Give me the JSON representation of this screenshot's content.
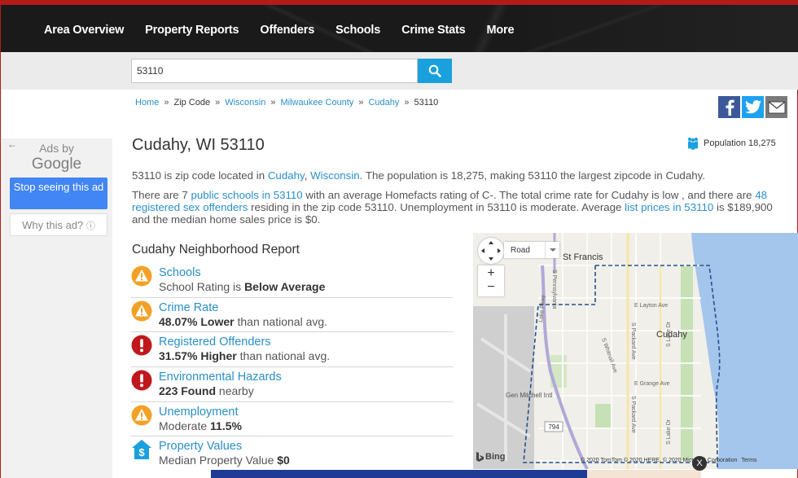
{
  "nav": {
    "items": [
      "Area Overview",
      "Property Reports",
      "Offenders",
      "Schools",
      "Crime Stats",
      "More"
    ]
  },
  "search": {
    "value": "53110"
  },
  "breadcrumb": {
    "home": "Home",
    "zip": "Zip Code",
    "state": "Wisconsin",
    "county": "Milwaukee County",
    "city": "Cudahy",
    "current": "53110",
    "sep": "»"
  },
  "ad": {
    "ads_by": "Ads by",
    "google": "Google",
    "stop": "Stop seeing this ad",
    "why": "Why this ad?",
    "back": "←",
    "info": "ⓘ"
  },
  "main": {
    "title": "Cudahy, WI 53110",
    "population": "Population 18,275",
    "p1_a": "53110 is zip code located in ",
    "p1_city": "Cudahy",
    "p1_comma": ", ",
    "p1_state": "Wisconsin",
    "p1_b": ". The population is 18,275, making 53110 the largest zipcode in Cudahy.",
    "p2_a": "There are 7 ",
    "p2_schools": "public schools in 53110",
    "p2_b": " with an average Homefacts rating of C-. The total crime rate for Cudahy is low , and there are ",
    "p2_offenders": "48 registered sex offenders",
    "p2_c": " residing in the zip code 53110. Unemployment in 53110 is moderate. Average ",
    "p2_prices": "list prices in 53110",
    "p2_d": " is $189,900 and the median home sales price is $0."
  },
  "report": {
    "title": "Cudahy Neighborhood Report",
    "items": [
      {
        "name": "Schools",
        "pre": "School Rating is ",
        "bold": "Below Average",
        "post": "",
        "kind": "warn"
      },
      {
        "name": "Crime Rate",
        "pre": "",
        "bold": "48.07% Lower",
        "post": " than national avg.",
        "kind": "warn"
      },
      {
        "name": "Registered Offenders",
        "pre": "",
        "bold": "31.57% Higher",
        "post": " than national avg.",
        "kind": "alert"
      },
      {
        "name": "Environmental Hazards",
        "pre": "",
        "bold": "223 Found",
        "post": " nearby",
        "kind": "alert"
      },
      {
        "name": "Unemployment",
        "pre": "Moderate ",
        "bold": "11.5%",
        "post": "",
        "kind": "warn"
      },
      {
        "name": "Property Values",
        "pre": "Median Property Value ",
        "bold": "$0",
        "post": "",
        "kind": "money"
      }
    ]
  },
  "map": {
    "mode": "Road",
    "labels": {
      "st_francis": "St Francis",
      "cudahy": "Cudahy",
      "layton": "E Layton Ave",
      "grange": "E Grange Ave",
      "packard": "S Packard Ave",
      "whitnall": "S Whitnall Ave",
      "lakedr": "S Lake Dr",
      "lake_pkwy": "Lake Pkwy",
      "pennsylvania": "S Pennsylvania",
      "gen_mitchell": "Gen Mitchell Intl",
      "route": "794",
      "bing": "Bing",
      "copyright": "© 2020 TomTom © 2020 HERE, © 2020 Microsoft Corporation",
      "terms": "Terms"
    },
    "zoom_in": "+",
    "zoom_out": "−"
  },
  "close": "X"
}
